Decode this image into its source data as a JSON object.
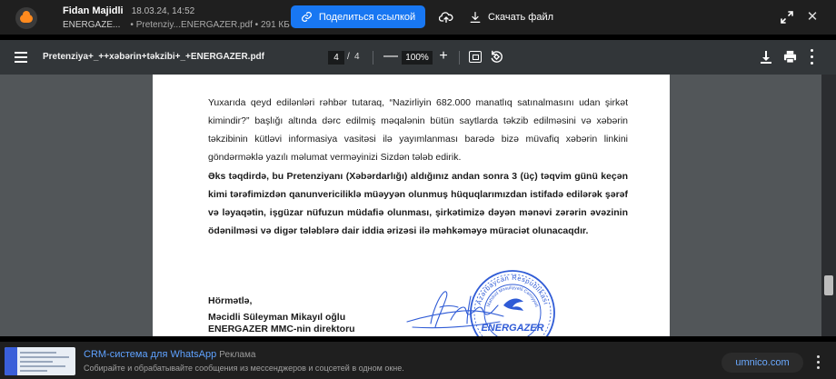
{
  "mail": {
    "sender_name": "Fidan Majidli",
    "date": "18.03.24, 14:52",
    "org": "ENERGAZE...",
    "attachment": "• Pretenziy...ENERGAZER.pdf • 291 КБ",
    "share_label": "Поделиться ссылкой",
    "download_label": "Скачать файл",
    "close_glyph": "✕"
  },
  "pdf": {
    "title": "Pretenziya+_++xəbərin+təkzibi+_+ENERGAZER.pdf",
    "current_page": "4",
    "separator": "/",
    "total_pages": "4",
    "zoom": "100%",
    "zoom_minus": "—",
    "zoom_plus": "+"
  },
  "document": {
    "paragraph1": "Yuxarıda qeyd edilənləri rəhbər tutaraq, “Nazirliyin 682.000 manatlıq satınalmasını udan şirkət kimindir?” başlığı altında dərc edilmiş məqalənin bütün saytlarda təkzib edilməsini və xəbərin təkzibinin kütləvi informasiya vasitəsi ilə yayımlanması barədə bizə müvafiq xəbərin linkini göndərməklə yazılı məlumat verməyinizi Sizdən tələb edirik.",
    "paragraph2": "Əks təqdirdə, bu Pretenziyanı (Xəbərdarlığı) aldığınız andan sonra 3 (üç) təqvim günü keçən kimi tərəfimizdən qanunvericiliklə müəyyən olunmuş hüquqlarımızdan istifadə edilərək şərəf və ləyaqətin, işgüzar nüfuzun müdafiə olunması, şirkətimizə dəyən mənəvi zərərin əvəzinin ödənilməsi və digər tələblərə dair iddia ərizəsi ilə məhkəməyə müraciət olunacaqdır.",
    "regards": "Hörmətlə,",
    "signer_name": "Məcidli Süleyman Mikayıl oğlu",
    "signer_role": "ENERGAZER MMC-nin direktoru",
    "stamp_top_text": "Azərbaycan Respublikası",
    "stamp_inner_text": "Məhdud Məsuliyyətli Cəmiyyəti",
    "stamp_brand": "ENERGAZER"
  },
  "ad": {
    "title": "CRM-система для WhatsApp",
    "tag": "Реклама",
    "description": "Собирайте и обрабатывайте сообщения из мессенджеров и соцсетей в одном окне.",
    "domain": "umnico.com"
  },
  "colors": {
    "accent": "#1877f2",
    "stamp": "#2f5bd6",
    "link": "#5fa2ff"
  }
}
